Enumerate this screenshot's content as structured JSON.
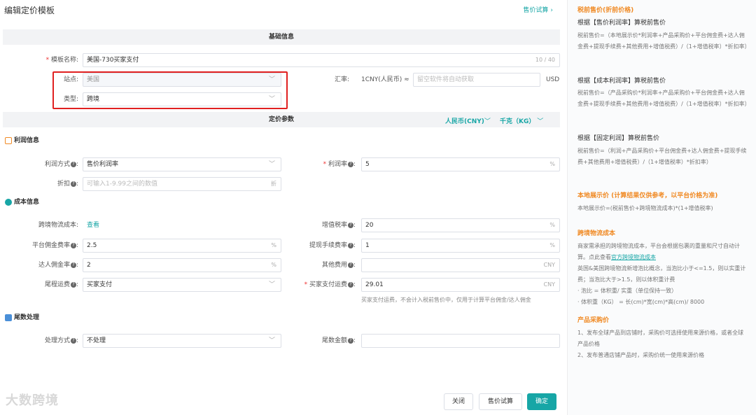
{
  "header": {
    "title": "编辑定价模板",
    "trial_link": "售价试算",
    "trial_chev": "›"
  },
  "bands": {
    "basic": "基础信息",
    "pricing": "定价参数"
  },
  "currency": {
    "rmb": "人民币(CNY)",
    "weight": "千克（KG）"
  },
  "basic": {
    "template_label": "模板名称:",
    "template_value": "美国-730买家支付",
    "template_count": "10 / 40",
    "site_label": "站点:",
    "site_value": "美国",
    "type_label": "类型:",
    "type_value": "跨境",
    "rate_label": "汇率:",
    "rate_text": "1CNY(人民币) ≈",
    "rate_placeholder": "留空软件将自动获取",
    "rate_unit": "USD"
  },
  "profit": {
    "section": "利润信息",
    "method_label": "利润方式",
    "method_value": "售价利润率",
    "rate_label": "利润率",
    "rate_value": "5",
    "rate_unit": "%",
    "discount_label": "折扣",
    "discount_placeholder": "可输入1-9.99之间的数值",
    "discount_unit": "折"
  },
  "cost": {
    "section": "成本信息",
    "logistics_label": "跨境物流成本:",
    "logistics_link": "查看",
    "vat_label": "增值税率",
    "vat_value": "20",
    "vat_unit": "%",
    "platform_label": "平台佣金费率",
    "platform_value": "2.5",
    "platform_unit": "%",
    "withdraw_label": "提现手续费率",
    "withdraw_value": "1",
    "withdraw_unit": "%",
    "influencer_label": "达人佣金率",
    "influencer_value": "2",
    "influencer_unit": "%",
    "other_label": "其他费用",
    "other_value": "",
    "other_unit": "CNY",
    "lastmile_label": "尾程运费",
    "lastmile_value": "买家支付",
    "buyer_ship_label": "买家支付运费",
    "buyer_ship_value": "29.01",
    "buyer_ship_unit": "CNY",
    "buyer_ship_hint": "买家支付运费，不会计入税前售价中，仅用于计算平台佣金/达人佣金"
  },
  "rounding": {
    "section": "尾数处理",
    "method_label": "处理方式",
    "method_value": "不处理",
    "amount_label": "尾数金额",
    "amount_value": ""
  },
  "buttons": {
    "close": "关闭",
    "trial": "售价试算",
    "confirm": "确定"
  },
  "watermark": "大数跨境",
  "sidebar": {
    "t1": "税前售价(折前价格)",
    "h1": "根据【售价利润率】算税前售价",
    "p1": "税前售价=（本地展示价*利润率+产品采购价+平台佣金费+达人佣金费+提现手续费+其他费用+增值税费）/（1+增值税率）*折扣率）",
    "h2": "根据【成本利润率】算税前售价",
    "p2": "税前售价=（产品采购价*利润率+产品采购价+平台佣金费+达人佣金费+提现手续费+其他费用+增值税费）/（1+增值税率）*折扣率）",
    "h3": "根据【固定利润】算税前售价",
    "p3": "税前售价=（利润+产品采购价+平台佣金费+达人佣金费+提现手续费+其他费用+增值税费）/（1+增值税率）*折扣率）",
    "t2": "本地展示价 (计算结果仅供参考，以平台价格为准)",
    "p4": "本地展示价=(税前售价+跨境物流成本)*(1+增值税率)",
    "t3": "跨境物流成本",
    "p5a": "商家需承担的跨境物流成本，平台会根据包裹的重量和尺寸自动计算。点此查看",
    "p5link": "官方跨境物流成本",
    "p5b": "英国&美国跨境物流新增泡比概念，当泡比小于<=1.5，则以实重计费；当泡比大于>1.5，则以体积重计费",
    "p5c": "· 泡比 = 体积重/ 实重（单位保持一致）",
    "p5d": "· 体积重（KG） = 长(cm)*宽(cm)*高(cm)/ 8000",
    "t4": "产品采购价",
    "p6a": "1、发布全球产品到店铺时，采购价可选择使用来源价格，或者全球产品价格",
    "p6b": "2、发布普通店铺产品时，采购价统一使用来源价格"
  }
}
